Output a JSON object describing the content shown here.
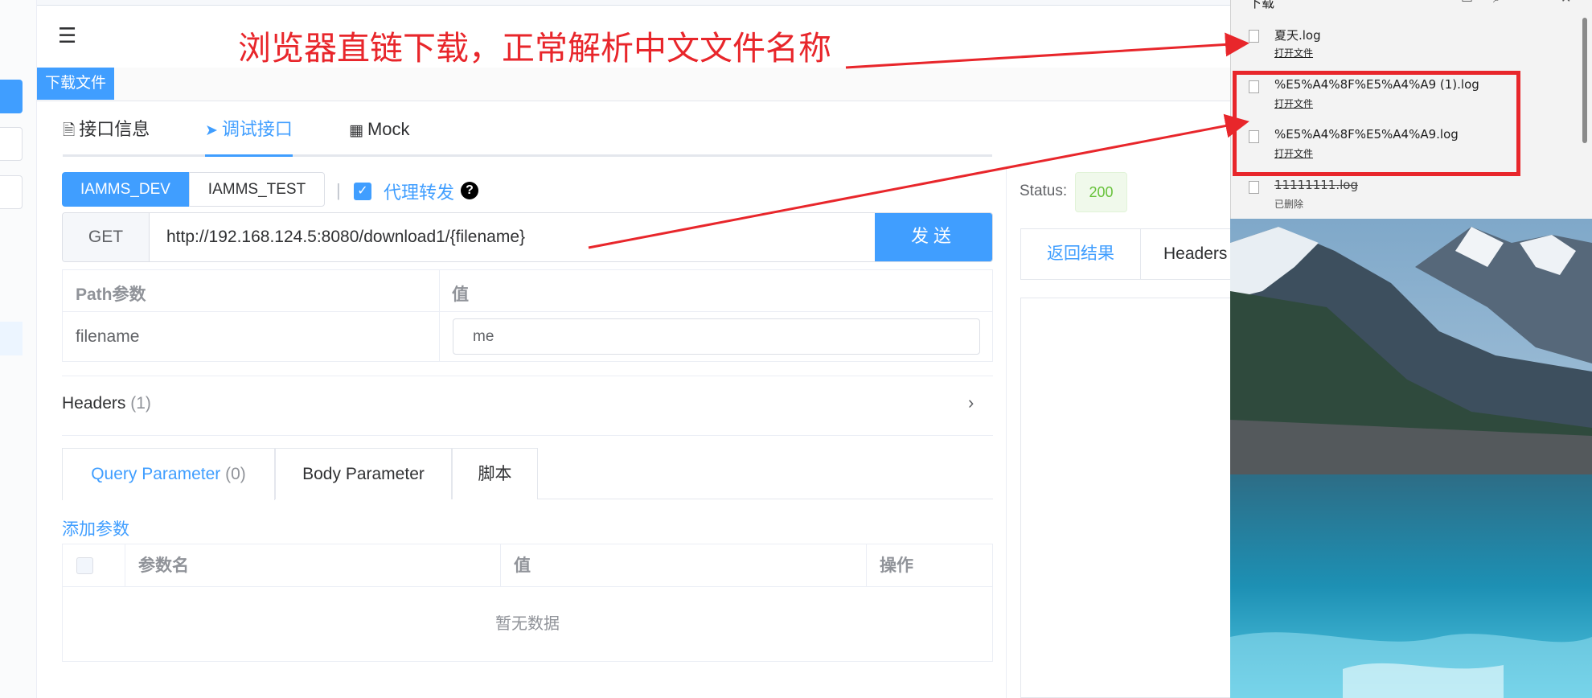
{
  "annotation": {
    "title": "浏览器直链下载，正常解析中文文件名称",
    "color": "#e8262b"
  },
  "menu_icon": "menu-fold-icon",
  "tag": {
    "label": "下载文件"
  },
  "main_tabs": [
    {
      "icon": "document-icon",
      "label": "接口信息"
    },
    {
      "icon": "paper-plane-icon",
      "label": "调试接口"
    },
    {
      "icon": "chart-icon",
      "label": "Mock"
    }
  ],
  "env": {
    "dev": "IAMMS_DEV",
    "test": "IAMMS_TEST"
  },
  "proxy": {
    "label": "代理转发",
    "checked": true
  },
  "request": {
    "method": "GET",
    "url": "http://192.168.124.5:8080/download1/{filename}",
    "send": "发送"
  },
  "path_table": {
    "headers": [
      "Path参数",
      "值"
    ],
    "rows": [
      {
        "name": "filename",
        "value": "me"
      }
    ]
  },
  "headers_section": {
    "label": "Headers",
    "count": "(1)"
  },
  "sub_tabs": [
    {
      "label": "Query Parameter",
      "count": "(0)"
    },
    {
      "label": "Body Parameter"
    },
    {
      "label": "脚本"
    }
  ],
  "add_param": "添加参数",
  "query_table": {
    "headers": [
      "参数名",
      "值",
      "操作"
    ],
    "empty": "暂无数据"
  },
  "response": {
    "status_label": "Status:",
    "status_code": "200",
    "tabs": [
      "返回结果",
      "Headers"
    ]
  },
  "downloads": {
    "title": "下载",
    "items": [
      {
        "name": "夏天.log",
        "action": "打开文件"
      },
      {
        "name": "%E5%A4%8F%E5%A4%A9 (1).log",
        "action": "打开文件"
      },
      {
        "name": "%E5%A4%8F%E5%A4%A9.log",
        "action": "打开文件"
      },
      {
        "name": "11111111.log",
        "action": "已删除",
        "deleted": true
      }
    ]
  },
  "colors": {
    "primary": "#409eff",
    "success": "#67c23a",
    "annotation": "#e8262b"
  }
}
